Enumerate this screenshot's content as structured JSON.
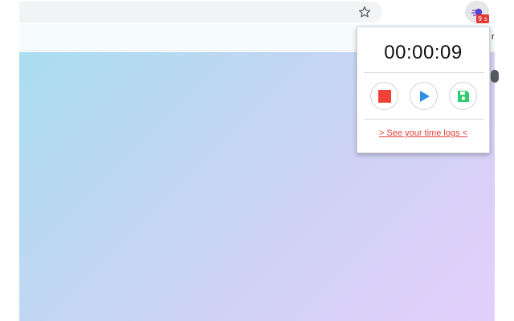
{
  "browser": {
    "bookmark_star_icon": "star-outline-icon",
    "extension_icon": "timer-extension-icon",
    "extension_badge": "9 s",
    "bookmarks_bar_overflow_text": "r"
  },
  "colors": {
    "stop": "#ef4136",
    "play": "#2f8de4",
    "save": "#2ecc71",
    "link": "#e0433a",
    "badge": "#e53935"
  },
  "popup": {
    "timer": "00:00:09",
    "controls": {
      "stop_icon": "stop-icon",
      "play_icon": "play-icon",
      "save_icon": "floppy-disk-icon"
    },
    "time_logs_link": "> See your time logs <"
  }
}
